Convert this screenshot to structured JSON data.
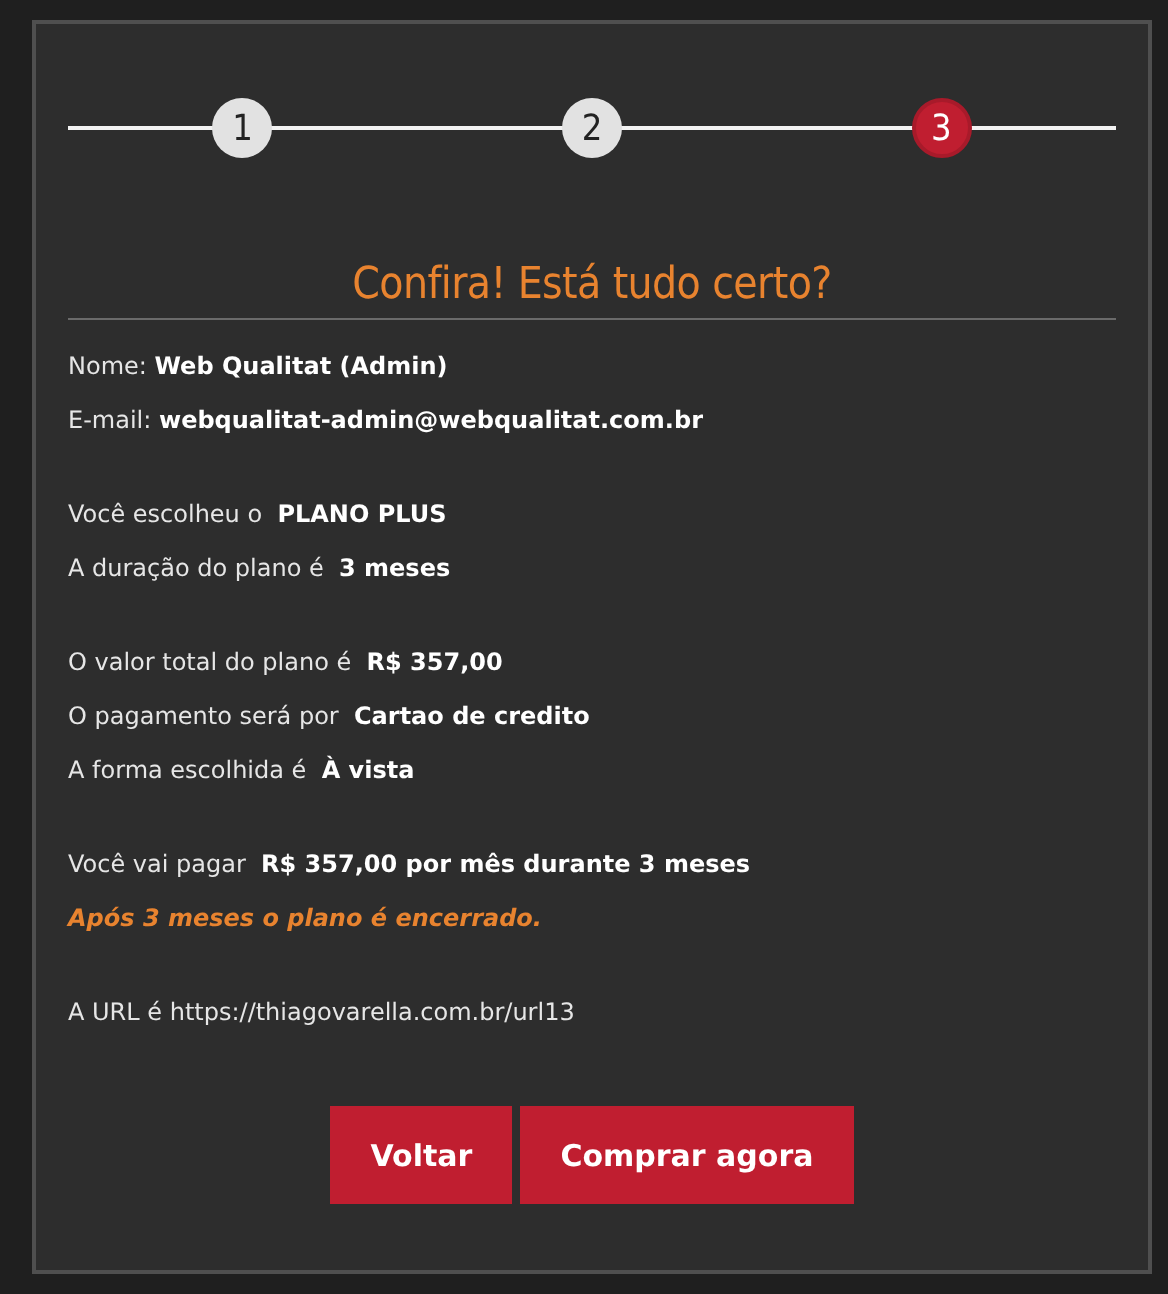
{
  "steps": [
    {
      "label": "1",
      "selected": false
    },
    {
      "label": "2",
      "selected": false
    },
    {
      "label": "3",
      "selected": true
    }
  ],
  "title": "Confira! Está tudo certo?",
  "groups": [
    [
      {
        "kind": "text",
        "text": "Nome: **Web Qualitat (Admin)**"
      },
      {
        "kind": "text",
        "text": "E-mail: **webqualitat-admin@webqualitat.com.br**"
      }
    ],
    [
      {
        "kind": "text",
        "text": "Você escolheu o  **PLANO PLUS**"
      },
      {
        "kind": "text",
        "text": "A duração do plano é  **3 meses**"
      }
    ],
    [
      {
        "kind": "text",
        "text": "O valor total do plano é  **R$ 357,00**"
      },
      {
        "kind": "text",
        "text": "O pagamento será por  **Cartao de credito**"
      },
      {
        "kind": "text",
        "text": "A forma escolhida é  **À vista**"
      }
    ],
    [
      {
        "kind": "text",
        "text": "Você vai pagar  **R$ 357,00 por mês durante 3 meses**"
      },
      {
        "kind": "note",
        "text": "Após 3 meses o plano é encerrado."
      }
    ],
    [
      {
        "kind": "text",
        "text": "A URL é https://thiagovarella.com.br/url13"
      }
    ]
  ],
  "buttons": [
    "Voltar",
    "Comprar agora"
  ]
}
